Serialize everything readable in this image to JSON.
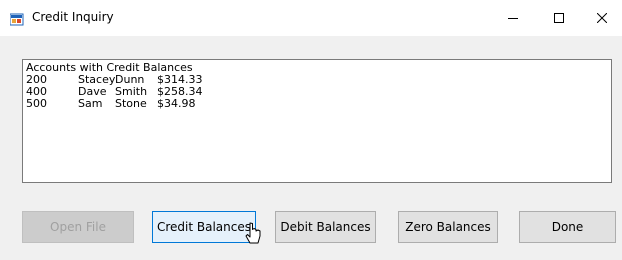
{
  "window": {
    "title": "Credit Inquiry"
  },
  "titlebar": {
    "minimize_icon": "minimize-icon",
    "maximize_icon": "maximize-icon",
    "close_icon": "close-icon"
  },
  "listbox": {
    "header": "Accounts with Credit Balances",
    "rows": [
      {
        "account": "200",
        "first": "Stacey",
        "last": "Dunn",
        "balance": "$314.33"
      },
      {
        "account": "400",
        "first": "Dave",
        "last": "Smith",
        "balance": "$258.34"
      },
      {
        "account": "500",
        "first": "Sam",
        "last": "Stone",
        "balance": "$34.98"
      }
    ]
  },
  "buttons": {
    "open_file": "Open File",
    "credit_balances": "Credit Balances",
    "debit_balances": "Debit Balances",
    "zero_balances": "Zero Balances",
    "done": "Done"
  },
  "colors": {
    "focus_border": "#0078d7",
    "window_bg": "#f0f0f0",
    "titlebar_bg": "#ffffff"
  }
}
